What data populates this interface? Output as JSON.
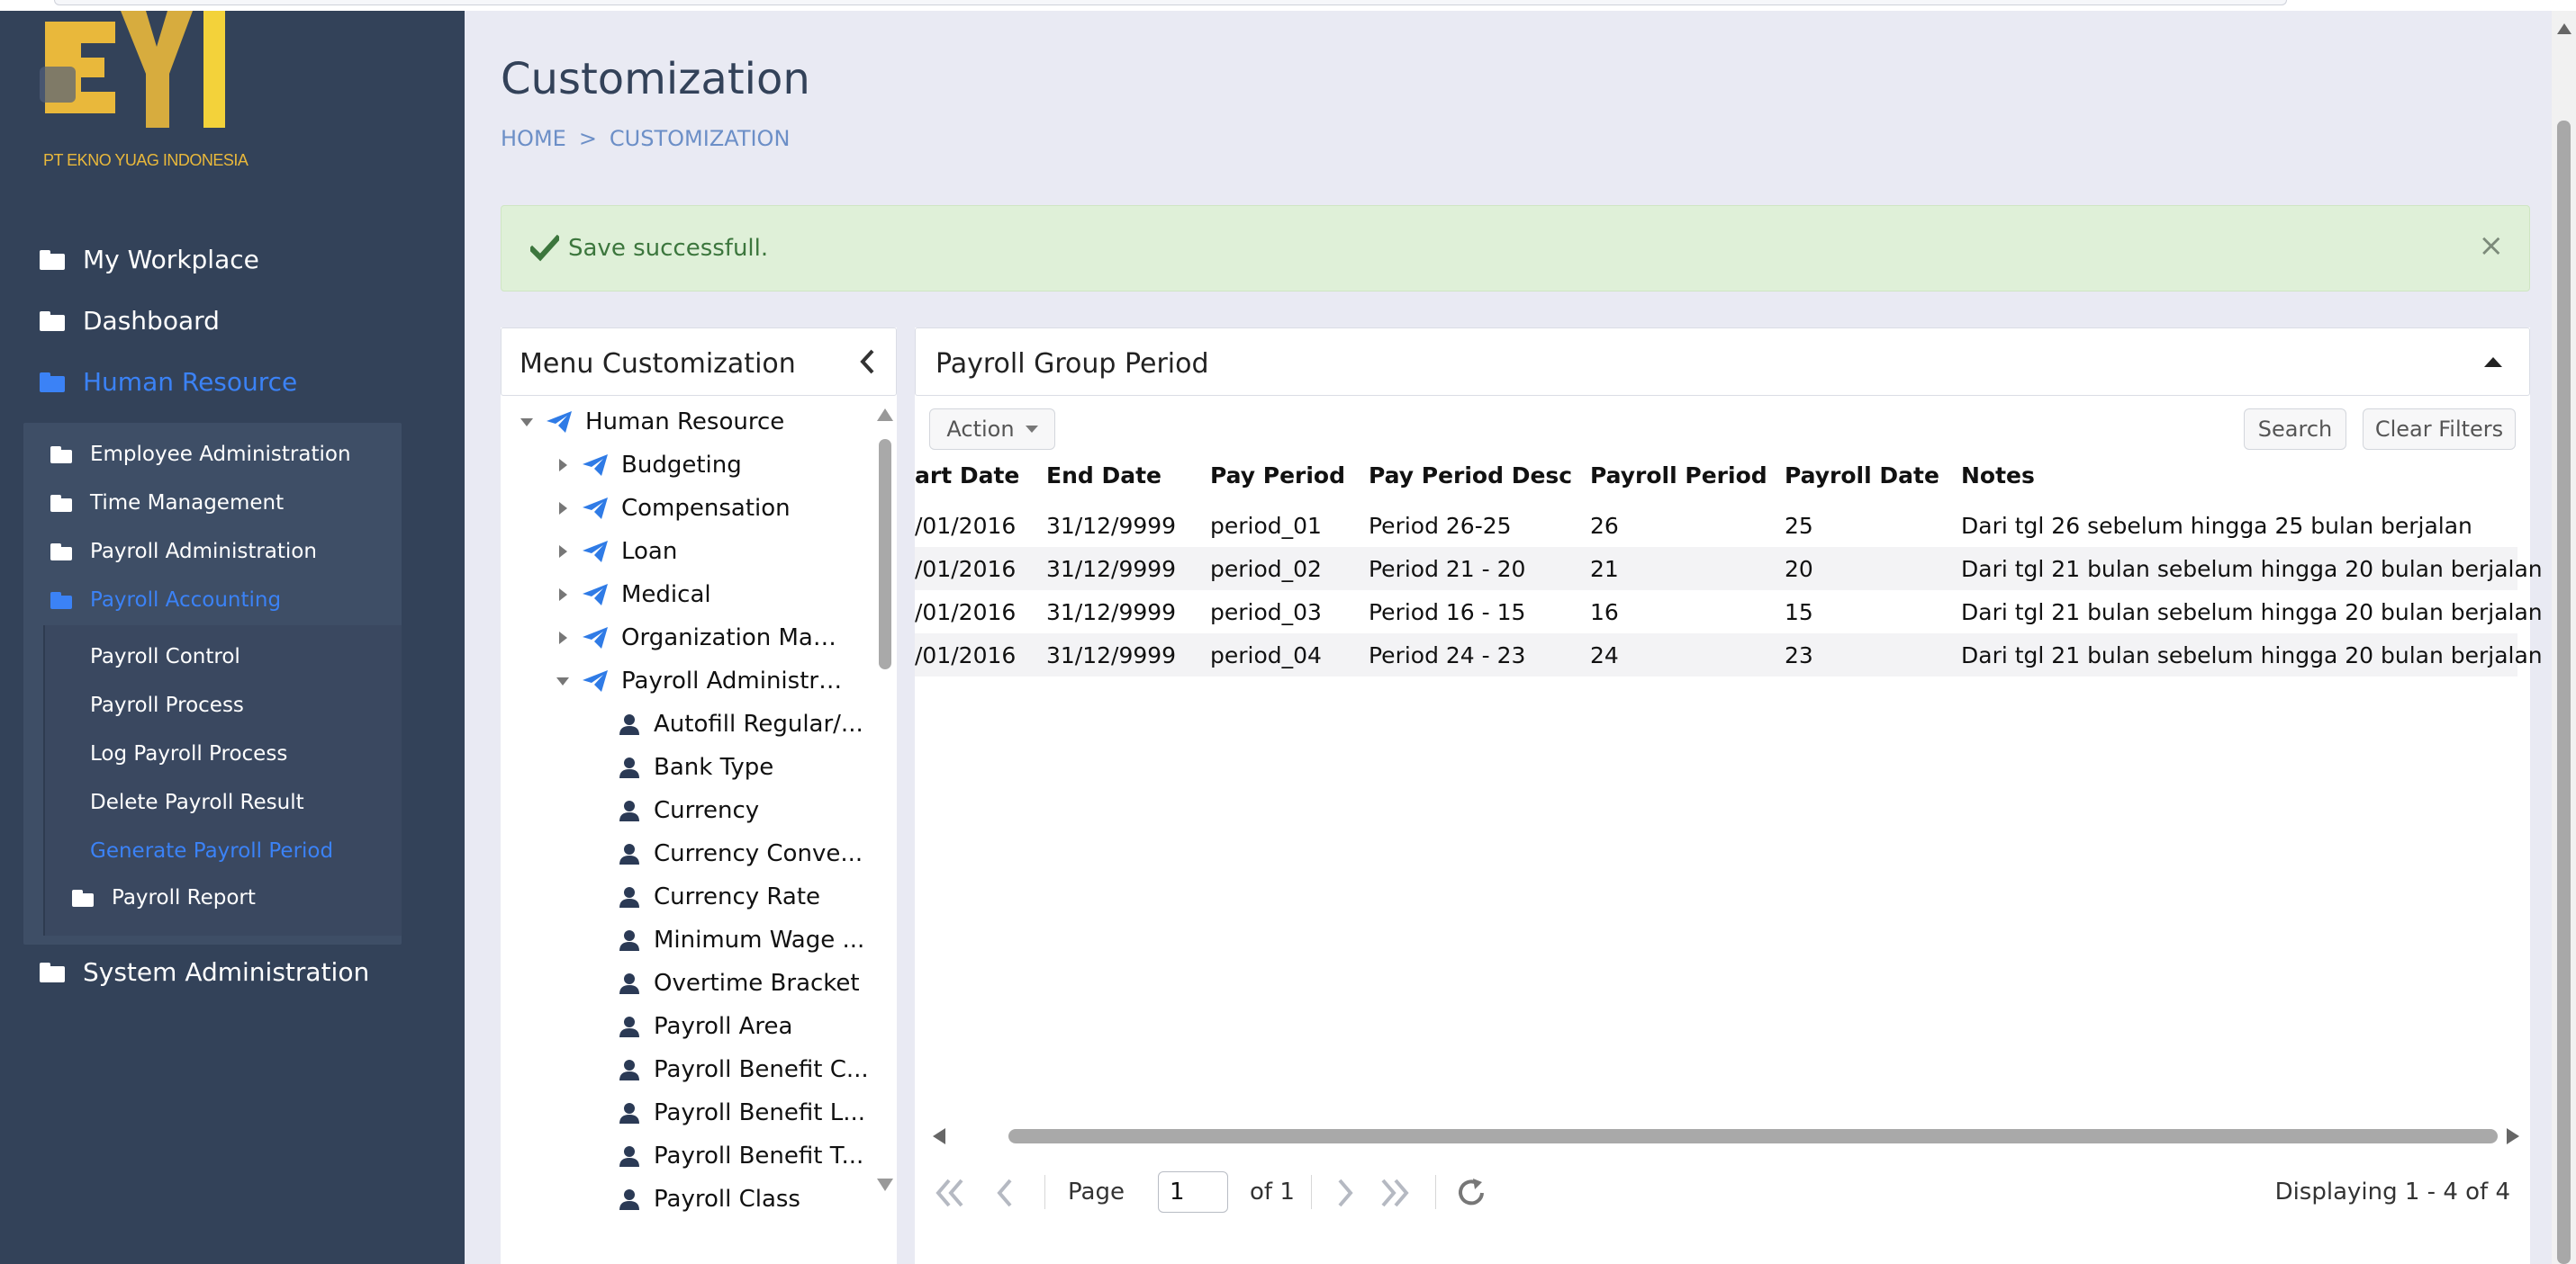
{
  "logo": {
    "letters": "EYI",
    "company": "PT EKNO YUAG INDONESIA"
  },
  "sidebar": {
    "items": [
      {
        "label": "My Workplace"
      },
      {
        "label": "Dashboard"
      },
      {
        "label": "Human Resource"
      },
      {
        "label": "System Administration"
      }
    ],
    "hr_sub": [
      {
        "label": "Employee Administration"
      },
      {
        "label": "Time Management"
      },
      {
        "label": "Payroll Administration"
      },
      {
        "label": "Payroll Accounting"
      }
    ],
    "accounting_sub": [
      {
        "label": "Payroll Control"
      },
      {
        "label": "Payroll Process"
      },
      {
        "label": "Log Payroll Process"
      },
      {
        "label": "Delete Payroll Result"
      },
      {
        "label": "Generate Payroll Period"
      }
    ],
    "payroll_report": {
      "label": "Payroll Report"
    }
  },
  "page": {
    "title": "Customization"
  },
  "breadcrumb": {
    "home": "HOME",
    "sep": ">",
    "current": "CUSTOMIZATION"
  },
  "alert": {
    "message": "Save successfull.",
    "close": "×",
    "color": "#3c763d"
  },
  "menu_panel": {
    "title": "Menu Customization",
    "tree": [
      {
        "label": "Human Resource"
      },
      {
        "label": "Budgeting"
      },
      {
        "label": "Compensation"
      },
      {
        "label": "Loan"
      },
      {
        "label": "Medical"
      },
      {
        "label": "Organization Manag..."
      },
      {
        "label": "Payroll Administrati..."
      },
      {
        "label": "Autofill Regular/..."
      },
      {
        "label": "Bank Type"
      },
      {
        "label": "Currency"
      },
      {
        "label": "Currency Conve..."
      },
      {
        "label": "Currency Rate"
      },
      {
        "label": "Minimum Wage ..."
      },
      {
        "label": "Overtime Bracket"
      },
      {
        "label": "Payroll Area"
      },
      {
        "label": "Payroll Benefit C..."
      },
      {
        "label": "Payroll Benefit L..."
      },
      {
        "label": "Payroll Benefit T..."
      },
      {
        "label": "Payroll Class"
      }
    ]
  },
  "grid_panel": {
    "title": "Payroll Group Period",
    "action_label": "Action",
    "search_label": "Search",
    "clear_label": "Clear Filters",
    "columns": [
      "art Date",
      "End Date",
      "Pay Period",
      "Pay Period Desc",
      "Payroll Period",
      "Payroll Date",
      "Notes"
    ],
    "rows": [
      [
        "/01/2016",
        "31/12/9999",
        "period_01",
        "Period 26-25",
        "26",
        "25",
        "Dari tgl 26 sebelum hingga 25 bulan berjalan"
      ],
      [
        "/01/2016",
        "31/12/9999",
        "period_02",
        "Period 21 - 20",
        "21",
        "20",
        "Dari tgl 21 bulan sebelum hingga 20 bulan berjalan"
      ],
      [
        "/01/2016",
        "31/12/9999",
        "period_03",
        "Period 16 - 15",
        "16",
        "15",
        "Dari tgl 21 bulan sebelum hingga 20 bulan berjalan"
      ],
      [
        "/01/2016",
        "31/12/9999",
        "period_04",
        "Period 24 - 23",
        "24",
        "23",
        "Dari tgl 21 bulan sebelum hingga 20 bulan berjalan"
      ]
    ],
    "pager": {
      "page_label": "Page",
      "page_value": "1",
      "of_label": "of 1",
      "display": "Displaying 1 - 4 of 4"
    }
  },
  "colors": {
    "sidebar_bg": "#334259",
    "accent": "#3b82f6",
    "alert_bg": "#dff0d8"
  }
}
